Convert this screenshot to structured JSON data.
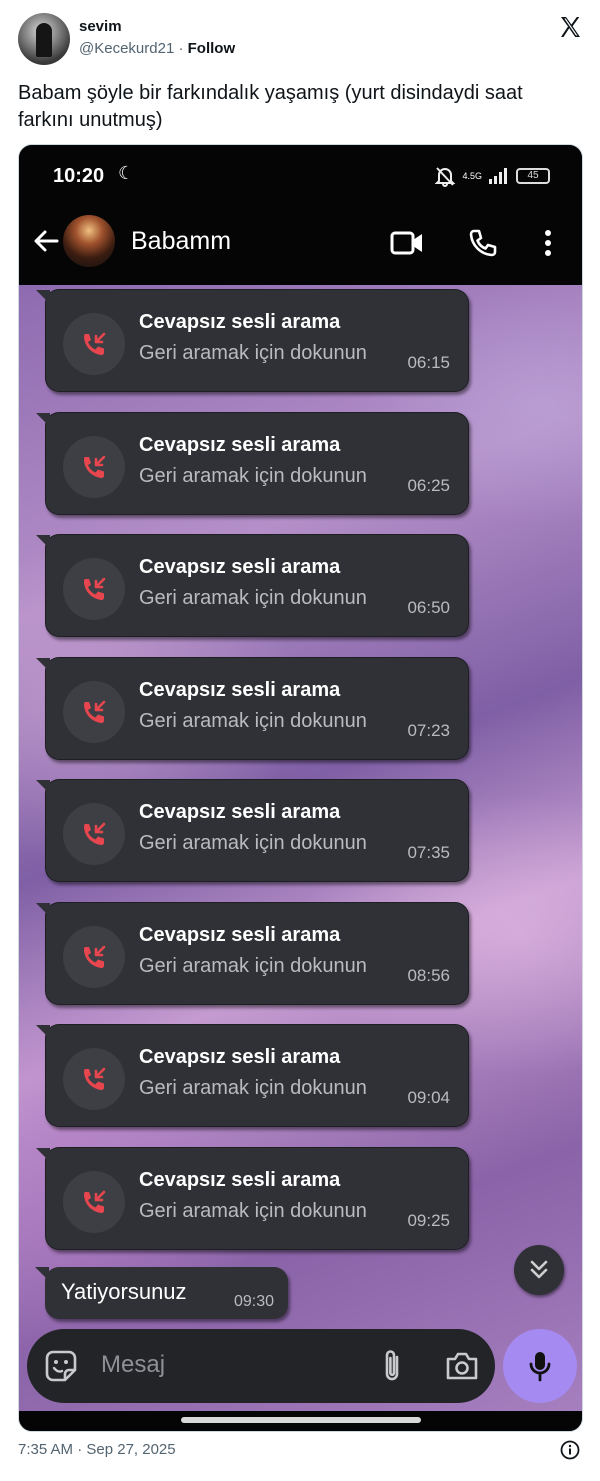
{
  "tweet": {
    "author_name": "sevim",
    "author_handle": "@Kecekurd21",
    "separator": " · ",
    "follow_label": "Follow",
    "text": "Babam şöyle bir farkındalık yaşamış (yurt disindaydi saat farkını unutmuş)",
    "posted_at": "7:35 AM · Sep 27, 2025"
  },
  "phone": {
    "status_time": "10:20",
    "status_moon": "☾",
    "network_label": "4.5G",
    "battery_label": "45",
    "contact_name": "Babamm",
    "missed_calls": [
      {
        "title": "Cevapsız sesli arama",
        "subtitle": "Geri aramak için dokunun",
        "time": "06:15"
      },
      {
        "title": "Cevapsız sesli arama",
        "subtitle": "Geri aramak için dokunun",
        "time": "06:25"
      },
      {
        "title": "Cevapsız sesli arama",
        "subtitle": "Geri aramak için dokunun",
        "time": "06:50"
      },
      {
        "title": "Cevapsız sesli arama",
        "subtitle": "Geri aramak için dokunun",
        "time": "07:23"
      },
      {
        "title": "Cevapsız sesli arama",
        "subtitle": "Geri aramak için dokunun",
        "time": "07:35"
      },
      {
        "title": "Cevapsız sesli arama",
        "subtitle": "Geri aramak için dokunun",
        "time": "08:56"
      },
      {
        "title": "Cevapsız sesli arama",
        "subtitle": "Geri aramak için dokunun",
        "time": "09:04"
      },
      {
        "title": "Cevapsız sesli arama",
        "subtitle": "Geri aramak için dokunun",
        "time": "09:25"
      }
    ],
    "last_message": {
      "text": "Yatiyorsunuz",
      "time": "09:30"
    },
    "composer_placeholder": "Mesaj"
  },
  "colors": {
    "missed_call_red": "#e8464f",
    "mic_button": "#a58af2",
    "bubble_bg": "#2f3136"
  },
  "icons": [
    "x-logo-icon",
    "back-arrow-icon",
    "video-call-icon",
    "phone-call-icon",
    "more-vert-icon",
    "missed-call-icon",
    "double-chevron-down-icon",
    "sticker-icon",
    "attach-icon",
    "camera-icon",
    "mic-icon",
    "info-icon",
    "mute-icon",
    "signal-icon"
  ]
}
